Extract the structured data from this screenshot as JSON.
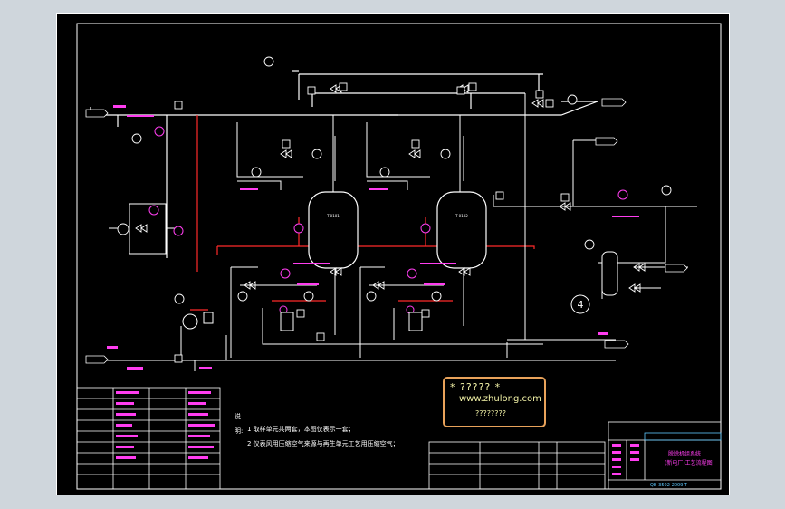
{
  "notes": {
    "header": "说明:",
    "items": [
      "1  取样单元共两套，本图仅表示一套；",
      "2  仪表风用压缩空气来源与再生单元工艺用压缩空气；"
    ]
  },
  "watermark": {
    "line1": "* ????? *",
    "line2": "www.zhulong.com",
    "line3": "????????"
  },
  "title_block": {
    "title_line1": "脱除机组系统",
    "title_line2": "(新电厂)工艺流程图",
    "drawing_number": "QB-3502-2009-T"
  },
  "vessel_tags": [
    "T-0101",
    "T-0102"
  ],
  "circle_label": "4",
  "colors": {
    "background": "#000000",
    "pipe": "#ffffff",
    "instrument": "#ff3df0",
    "hot_line": "#ff2a2a",
    "cyan": "#5ec9ff"
  }
}
